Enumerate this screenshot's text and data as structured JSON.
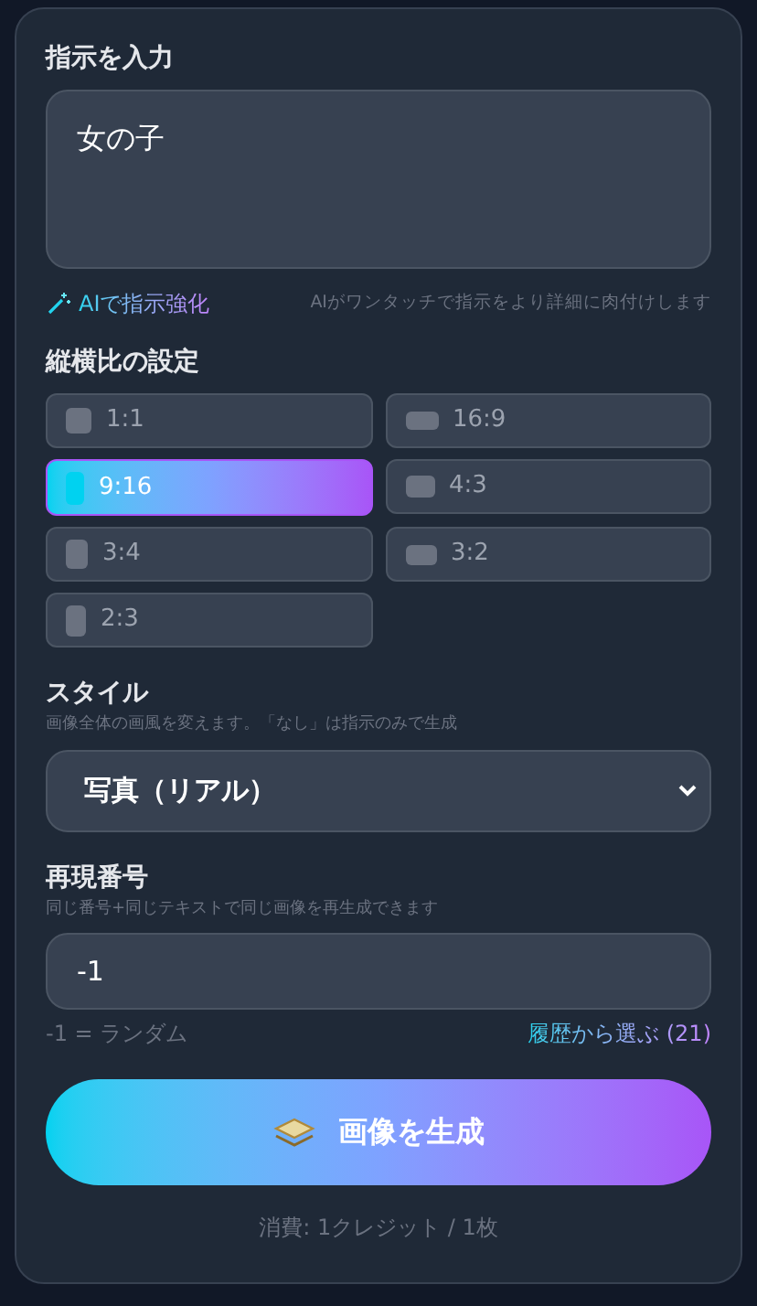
{
  "prompt": {
    "label": "指示を入力",
    "value": "女の子"
  },
  "enhance": {
    "label": "AIで指示強化",
    "hint": "AIがワンタッチで指示をより詳細に肉付けします"
  },
  "aspect": {
    "label": "縦横比の設定",
    "options": [
      {
        "label": "1:1",
        "kind": "square",
        "selected": false
      },
      {
        "label": "16:9",
        "kind": "wide",
        "selected": false
      },
      {
        "label": "9:16",
        "kind": "tall",
        "selected": true
      },
      {
        "label": "4:3",
        "kind": "landscape",
        "selected": false
      },
      {
        "label": "3:4",
        "kind": "portrait",
        "selected": false
      },
      {
        "label": "3:2",
        "kind": "photo-landscape",
        "selected": false
      },
      {
        "label": "2:3",
        "kind": "photo-portrait",
        "selected": false
      }
    ]
  },
  "style": {
    "label": "スタイル",
    "hint": "画像全体の画風を変えます。「なし」は指示のみで生成",
    "value": "写真（リアル）"
  },
  "seed": {
    "label": "再現番号",
    "hint": "同じ番号+同じテキストで同じ画像を再生成できます",
    "value": "-1",
    "note": "-1 = ランダム",
    "history": "履歴から選ぶ (21)"
  },
  "generate": {
    "label": "画像を生成"
  },
  "footer": "消費: 1クレジット / 1枚"
}
